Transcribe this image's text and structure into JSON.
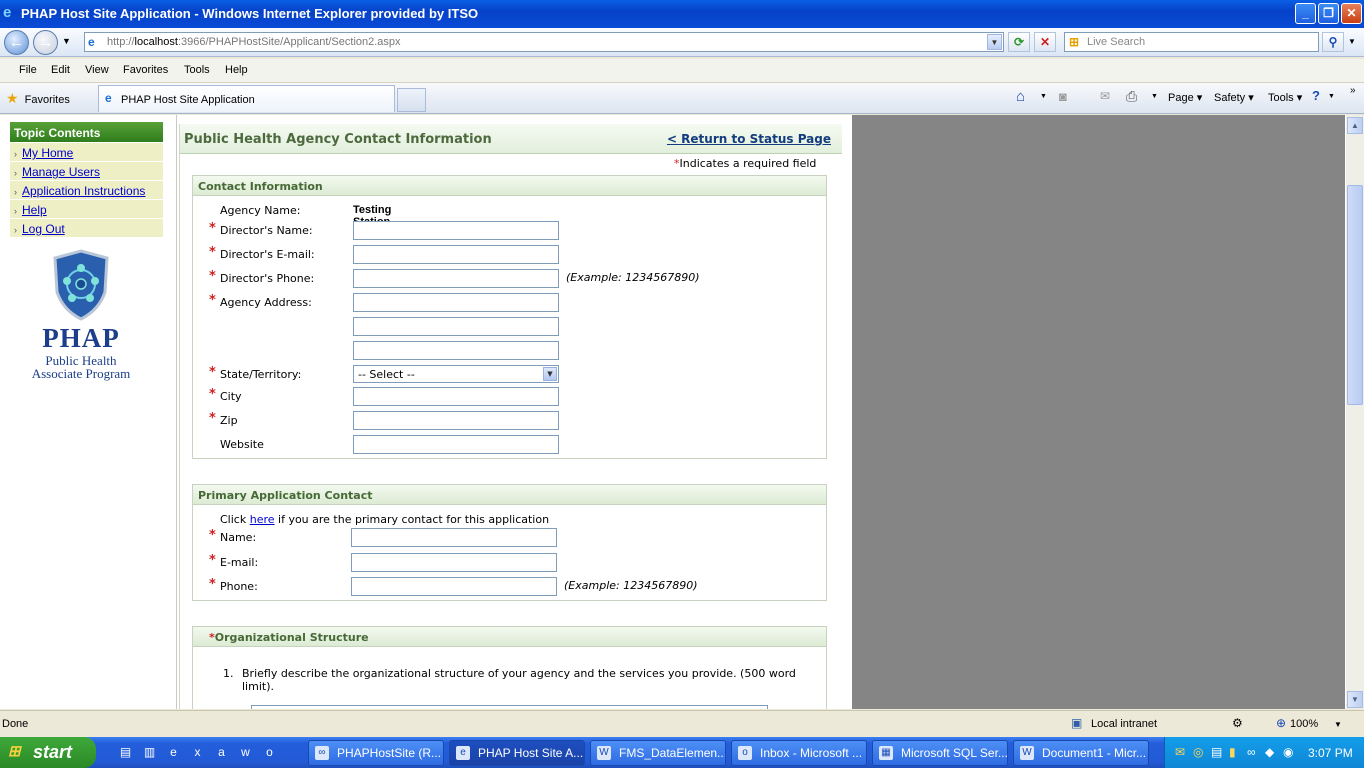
{
  "window": {
    "title": "PHAP Host Site Application - Windows Internet Explorer provided by ITSO"
  },
  "address": {
    "url_prefix": "http://",
    "url_host": "localhost",
    "url_rest": ":3966/PHAPHostSite/Applicant/Section2.aspx"
  },
  "search": {
    "placeholder": "Live Search"
  },
  "menu": {
    "file": "File",
    "edit": "Edit",
    "view": "View",
    "favorites": "Favorites",
    "tools": "Tools",
    "help": "Help"
  },
  "favbar": {
    "favorites": "Favorites",
    "tab_title": "PHAP Host Site Application"
  },
  "cmdbar": {
    "page": "Page",
    "safety": "Safety",
    "tools": "Tools"
  },
  "toc": {
    "header": "Topic Contents",
    "items": [
      {
        "label": "My Home"
      },
      {
        "label": "Manage Users"
      },
      {
        "label": "Application Instructions"
      },
      {
        "label": "Help"
      },
      {
        "label": "Log Out"
      }
    ]
  },
  "logo": {
    "line1": "PHAP",
    "line2": "Public Health",
    "line3": "Associate Program"
  },
  "main": {
    "title": "Public Health Agency Contact Information",
    "return_link": "< Return to Status Page",
    "required_note": "Indicates a required field"
  },
  "contact": {
    "header": "Contact Information",
    "agency_label": "Agency Name:",
    "agency_value": "Testing Station",
    "director_name": "Director's Name:",
    "director_email": "Director's E-mail:",
    "director_phone": "Director's Phone:",
    "phone_example": "(Example: 1234567890)",
    "address": "Agency Address:",
    "state": "State/Territory:",
    "state_value": "-- Select --",
    "city": "City",
    "zip": "Zip",
    "website": "Website"
  },
  "primary": {
    "header": "Primary Application Contact",
    "click_pre": "Click",
    "click_link": "here",
    "click_post": "if you are the primary contact for this application",
    "name": "Name:",
    "email": "E-mail:",
    "phone": "Phone:",
    "phone_example": "(Example: 1234567890)"
  },
  "org": {
    "header": "Organizational Structure",
    "q1_num": "1.",
    "q1": "Briefly describe the organizational structure of your agency and the services you provide. (500 word limit)."
  },
  "status": {
    "done": "Done",
    "zone": "Local intranet",
    "zoom": "100%"
  },
  "taskbar": {
    "start": "start",
    "buttons": [
      {
        "label": "PHAPHostSite (R..."
      },
      {
        "label": "PHAP Host Site A..."
      },
      {
        "label": "FMS_DataElemen..."
      },
      {
        "label": "Inbox - Microsoft ..."
      },
      {
        "label": "Microsoft SQL Ser..."
      },
      {
        "label": "Document1 - Micr..."
      }
    ],
    "clock": "3:07 PM"
  }
}
